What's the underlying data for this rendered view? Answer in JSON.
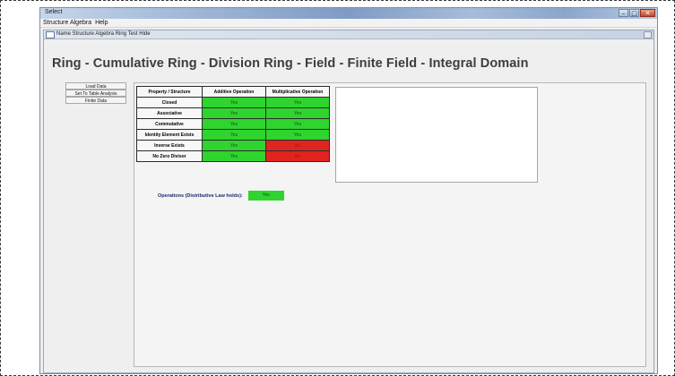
{
  "window": {
    "title": "Select",
    "controls": [
      "–",
      "□",
      "✕"
    ]
  },
  "menubar": {
    "items": [
      "Structure Algebra",
      "Help"
    ]
  },
  "inner_frame": {
    "title": "Name Structure Algebra Ring Test Hide",
    "icon": "window-icon"
  },
  "hierarchy": {
    "text": "Ring - Cumulative Ring - Division Ring - Field - Finite Field - Integral Domain"
  },
  "sidebar": {
    "items": [
      {
        "label": "Load Data"
      },
      {
        "label": "Set To Table Analysis"
      },
      {
        "label": "Finite Data"
      }
    ]
  },
  "table": {
    "headers": [
      "Property / Structure",
      "Additive Operation",
      "Multiplicative Operation"
    ],
    "rows": [
      {
        "label": "Closed",
        "a": "Yes",
        "b": "Yes",
        "a_status": "green",
        "b_status": "green"
      },
      {
        "label": "Associative",
        "a": "Yes",
        "b": "Yes",
        "a_status": "green",
        "b_status": "green"
      },
      {
        "label": "Commutative",
        "a": "Yes",
        "b": "Yes",
        "a_status": "green",
        "b_status": "green"
      },
      {
        "label": "Identity Element Exists",
        "a": "Yes",
        "b": "Yes",
        "a_status": "green",
        "b_status": "green"
      },
      {
        "label": "Inverse Exists",
        "a": "Yes",
        "b": "No",
        "a_status": "green",
        "b_status": "red"
      },
      {
        "label": "No Zero Divisor",
        "a": "Yes",
        "b": "No",
        "a_status": "green",
        "b_status": "red"
      }
    ]
  },
  "operations": {
    "label": "Operations (Distributive Law holds):",
    "value": "Yes"
  },
  "colors": {
    "yes": "#2fd42f",
    "no": "#e0241f"
  }
}
